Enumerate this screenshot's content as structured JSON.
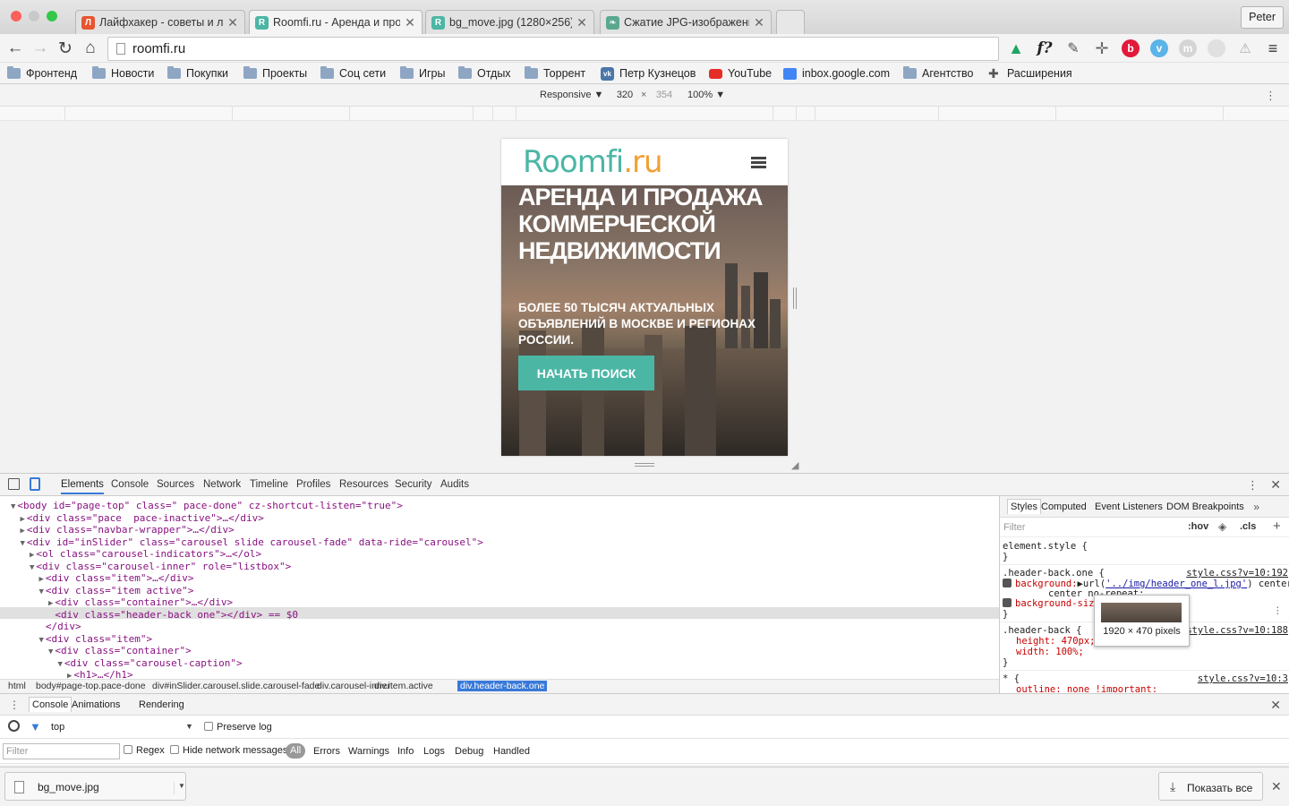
{
  "tabs": [
    {
      "title": "Лайфхакер - советы и лайфхаки",
      "favicon": "lifehacker-icon",
      "fav_color": "#e8552f",
      "glyph": "Л"
    },
    {
      "title": "Roomfi.ru - Аренда и продажа",
      "favicon": "roomfi-icon",
      "fav_color": "#4cb6a5",
      "glyph": "R"
    },
    {
      "title": "bg_move.jpg (1280×256)",
      "favicon": "roomfi-icon",
      "fav_color": "#4cb6a5",
      "glyph": "R"
    },
    {
      "title": "Сжатие JPG-изображений",
      "favicon": "leaf-icon",
      "fav_color": "#5aa88f",
      "glyph": "❧"
    }
  ],
  "profile": "Peter",
  "address": "roomfi.ru",
  "bookmarks": [
    "Фронтенд",
    "Новости",
    "Покупки",
    "Проекты",
    "Соц сети",
    "Игры",
    "Отдых",
    "Торрент",
    "Петр Кузнецов",
    "YouTube",
    "inbox.google.com",
    "Агентство",
    "Расширения"
  ],
  "device": {
    "mode": "Responsive",
    "width": "320",
    "height": "354",
    "zoom": "100%",
    "sep": "×"
  },
  "site": {
    "logo_main": "Roomfi",
    "logo_tld": ".ru",
    "headline": "АРЕНДА И ПРОДАЖА КОММЕРЧЕСКОЙ НЕДВИЖИМОСТИ",
    "subline": "БОЛЕЕ 50 ТЫСЯЧ АКТУАЛЬНЫХ ОБЪЯВЛЕНИЙ В МОСКВЕ И РЕГИОНАХ РОССИИ.",
    "cta": "НАЧАТЬ ПОИСК"
  },
  "devtools_tabs": [
    "Elements",
    "Console",
    "Sources",
    "Network",
    "Timeline",
    "Profiles",
    "Resources",
    "Security",
    "Audits"
  ],
  "dom_lines": [
    {
      "indent": 0,
      "arrow": "▼",
      "html": "<body id=\"page-top\" class=\" pace-done\" cz-shortcut-listen=\"true\">"
    },
    {
      "indent": 1,
      "arrow": "▶",
      "html": "<div class=\"pace  pace-inactive\">…</div>"
    },
    {
      "indent": 1,
      "arrow": "▶",
      "html": "<div class=\"navbar-wrapper\">…</div>"
    },
    {
      "indent": 1,
      "arrow": "▼",
      "html": "<div id=\"inSlider\" class=\"carousel slide carousel-fade\" data-ride=\"carousel\">"
    },
    {
      "indent": 2,
      "arrow": "▶",
      "html": "<ol class=\"carousel-indicators\">…</ol>"
    },
    {
      "indent": 2,
      "arrow": "▼",
      "html": "<div class=\"carousel-inner\" role=\"listbox\">"
    },
    {
      "indent": 3,
      "arrow": "▶",
      "html": "<div class=\"item\">…</div>"
    },
    {
      "indent": 3,
      "arrow": "▼",
      "html": "<div class=\"item active\">"
    },
    {
      "indent": 4,
      "arrow": "▶",
      "html": "<div class=\"container\">…</div>"
    },
    {
      "indent": 4,
      "arrow": "",
      "html": "<div class=\"header-back one\"></div> == $0"
    },
    {
      "indent": 3,
      "arrow": "",
      "html": "</div>"
    },
    {
      "indent": 3,
      "arrow": "▼",
      "html": "<div class=\"item\">"
    },
    {
      "indent": 4,
      "arrow": "▼",
      "html": "<div class=\"container\">"
    },
    {
      "indent": 5,
      "arrow": "▼",
      "html": "<div class=\"carousel-caption\">"
    },
    {
      "indent": 6,
      "arrow": "▶",
      "html": "<h1>…</h1>"
    }
  ],
  "breadcrumbs": [
    "html",
    "body#page-top.pace-done",
    "div#inSlider.carousel.slide.carousel-fade",
    "div.carousel-inner",
    "div.item.active",
    "div.header-back.one"
  ],
  "styles_tabs": [
    "Styles",
    "Computed",
    "Event Listeners",
    "DOM Breakpoints"
  ],
  "styles": {
    "filter": "Filter",
    "hov": ":hov",
    "cls": ".cls",
    "element_style": "element.style {",
    "close": "}",
    "rule1_selector": ".header-back.one {",
    "rule1_src": "style.css?v=10:192",
    "rule1_bg": "background:",
    "rule1_url": "'../img/header_one_l.jpg'",
    "rule1_rest": "center",
    "rule1_line2": "center no-repeat;",
    "rule1_size": "background-size",
    "rule2_selector": ".header-back {",
    "rule2_src": "style.css?v=10:188",
    "rule2_height": "height: 470px;",
    "rule2_width": "width: 100%;",
    "rule3_selector": "* {",
    "rule3_src": "style.css?v=10:3",
    "rule3_outline": "outline: none !important;"
  },
  "tooltip": "1920 × 470 pixels",
  "drawer_tabs": [
    "Console",
    "Animations",
    "Rendering"
  ],
  "console": {
    "context": "top",
    "preserve": "Preserve log",
    "filter": "Filter",
    "regex": "Regex",
    "hide_net": "Hide network messages",
    "all": "All",
    "levels": [
      "Errors",
      "Warnings",
      "Info",
      "Logs",
      "Debug",
      "Handled"
    ]
  },
  "download": {
    "file": "bg_move.jpg",
    "show_all": "Показать все"
  }
}
